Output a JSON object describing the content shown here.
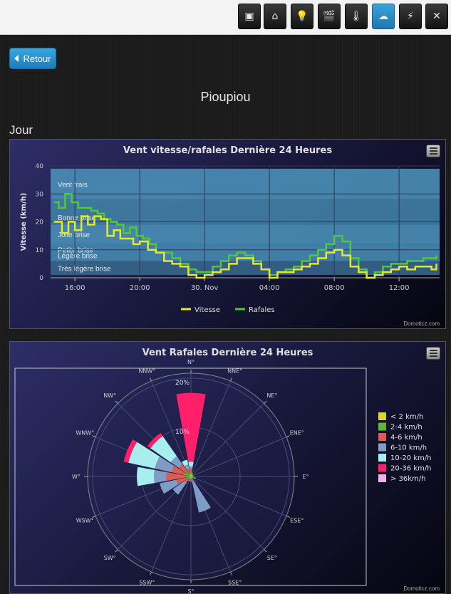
{
  "toolbar": {
    "buttons": [
      {
        "name": "dashboard-icon",
        "glyph": "▣",
        "active": false
      },
      {
        "name": "switches-icon",
        "glyph": "⌂",
        "active": false
      },
      {
        "name": "lightbulb-icon",
        "glyph": "💡",
        "active": false
      },
      {
        "name": "scenes-icon",
        "glyph": "🎬",
        "active": false
      },
      {
        "name": "temperature-icon",
        "glyph": "🌡",
        "active": false
      },
      {
        "name": "weather-icon",
        "glyph": "☁",
        "active": true
      },
      {
        "name": "utility-icon",
        "glyph": "⚡",
        "active": false
      },
      {
        "name": "setup-icon",
        "glyph": "✕",
        "active": false
      }
    ]
  },
  "back_label": "Retour",
  "page_title": "Pioupiou",
  "section_title": "Jour",
  "credit": "Domoticz.com",
  "chart_data": [
    {
      "type": "line",
      "title": "Vent vitesse/rafales Dernière 24 Heures",
      "ylabel": "Vitesse (km/h)",
      "ylim": [
        0,
        40
      ],
      "yticks": [
        0,
        10,
        20,
        30,
        40
      ],
      "xticks": [
        "16:00",
        "20:00",
        "30. Nov",
        "04:00",
        "08:00",
        "12:00"
      ],
      "x_hours": [
        14.5,
        38.5
      ],
      "xtick_hours": [
        16,
        20,
        24,
        28,
        32,
        36
      ],
      "bands": [
        {
          "label": "Vent frais",
          "from": 28,
          "to": 39
        },
        {
          "label": "Bonne brise",
          "from": 19,
          "to": 28
        },
        {
          "label": "Jolie brise",
          "from": 12,
          "to": 19
        },
        {
          "label": "Petite brise",
          "from": 6,
          "to": 12
        },
        {
          "label": "Légère brise",
          "from": 6,
          "to": 12
        },
        {
          "label": "Très légère brise",
          "from": 1,
          "to": 6
        }
      ],
      "series": [
        {
          "name": "Vitesse",
          "color": "#e8e82a",
          "values": [
            [
              14.7,
              20
            ],
            [
              15.2,
              16
            ],
            [
              15.6,
              20
            ],
            [
              16,
              17
            ],
            [
              16.4,
              22
            ],
            [
              16.8,
              19
            ],
            [
              17.2,
              22
            ],
            [
              17.6,
              21
            ],
            [
              18,
              15
            ],
            [
              18.4,
              17
            ],
            [
              18.8,
              14
            ],
            [
              19.2,
              14
            ],
            [
              19.6,
              12
            ],
            [
              20,
              13
            ],
            [
              20.5,
              10
            ],
            [
              21,
              9
            ],
            [
              21.5,
              6
            ],
            [
              22,
              5
            ],
            [
              22.5,
              4
            ],
            [
              23,
              1
            ],
            [
              23.5,
              0
            ],
            [
              24,
              1
            ],
            [
              24.5,
              2
            ],
            [
              25,
              3
            ],
            [
              25.5,
              5
            ],
            [
              26,
              7
            ],
            [
              26.5,
              7
            ],
            [
              27,
              5
            ],
            [
              27.5,
              3
            ],
            [
              28,
              0
            ],
            [
              28.5,
              2
            ],
            [
              29,
              2
            ],
            [
              29.5,
              3
            ],
            [
              30,
              4
            ],
            [
              30.5,
              5
            ],
            [
              31,
              7
            ],
            [
              31.5,
              9
            ],
            [
              32,
              10
            ],
            [
              32.5,
              8
            ],
            [
              33,
              4
            ],
            [
              33.5,
              2
            ],
            [
              34,
              0
            ],
            [
              34.5,
              1
            ],
            [
              35,
              2
            ],
            [
              35.5,
              3
            ],
            [
              36,
              4
            ],
            [
              36.5,
              3
            ],
            [
              37,
              4
            ],
            [
              37.5,
              4
            ],
            [
              38,
              3
            ],
            [
              38.3,
              5
            ]
          ]
        },
        {
          "name": "Rafales",
          "color": "#4fc83c",
          "values": [
            [
              14.7,
              27
            ],
            [
              15,
              25
            ],
            [
              15.4,
              30
            ],
            [
              15.8,
              27
            ],
            [
              16.2,
              25
            ],
            [
              16.6,
              25
            ],
            [
              17,
              24
            ],
            [
              17.4,
              23
            ],
            [
              17.8,
              21
            ],
            [
              18.2,
              20
            ],
            [
              18.6,
              19
            ],
            [
              19,
              16
            ],
            [
              19.4,
              18
            ],
            [
              19.8,
              15
            ],
            [
              20.2,
              14
            ],
            [
              20.6,
              12
            ],
            [
              21,
              9
            ],
            [
              21.5,
              9
            ],
            [
              22,
              7
            ],
            [
              22.5,
              5
            ],
            [
              23,
              3
            ],
            [
              23.5,
              2
            ],
            [
              24,
              2
            ],
            [
              24.5,
              4
            ],
            [
              25,
              6
            ],
            [
              25.5,
              8
            ],
            [
              26,
              9
            ],
            [
              26.5,
              8
            ],
            [
              27,
              6
            ],
            [
              27.5,
              3
            ],
            [
              28,
              1
            ],
            [
              28.5,
              2
            ],
            [
              29,
              3
            ],
            [
              29.5,
              4
            ],
            [
              30,
              6
            ],
            [
              30.5,
              8
            ],
            [
              31,
              10
            ],
            [
              31.5,
              12
            ],
            [
              32,
              15
            ],
            [
              32.5,
              13
            ],
            [
              33,
              7
            ],
            [
              33.5,
              3
            ],
            [
              34,
              0
            ],
            [
              34.5,
              2
            ],
            [
              35,
              4
            ],
            [
              35.5,
              5
            ],
            [
              36,
              5
            ],
            [
              36.5,
              6
            ],
            [
              37,
              6
            ],
            [
              37.5,
              7
            ],
            [
              38,
              7
            ],
            [
              38.3,
              8
            ]
          ]
        }
      ]
    },
    {
      "type": "polar-bar",
      "title": "Vent Rafales Dernière 24 Heures",
      "directions": [
        "N°",
        "NNE°",
        "NE°",
        "ENE°",
        "E°",
        "ESE°",
        "SE°",
        "SSE°",
        "S°",
        "SSW°",
        "SW°",
        "WSW°",
        "W°",
        "WNW°",
        "NW°",
        "NNW°"
      ],
      "radial_labels": [
        "10%",
        "20%"
      ],
      "rmax_percent": 21,
      "categories": [
        "< 2 km/h",
        "2-4 km/h",
        "4-6 km/h",
        "6-10 km/h",
        "10-20 km/h",
        "20-36 km/h",
        "> 36km/h"
      ],
      "colors": [
        "#d8d81c",
        "#58b83a",
        "#d95d52",
        "#7e9cc4",
        "#a8eeee",
        "#ff1f6b",
        "#f3b0ee"
      ],
      "series_cumulative_percent": [
        [
          0.6,
          1.0,
          1.5,
          2.0,
          3.0,
          17.0,
          17.0
        ],
        [
          0.4,
          0.8,
          0.8,
          0.8,
          0.8,
          0.8,
          0.8
        ],
        [
          0.3,
          0.5,
          0.5,
          0.5,
          0.5,
          0.5,
          0.5
        ],
        [
          0.3,
          0.5,
          0.5,
          0.5,
          0.5,
          0.5,
          0.5
        ],
        [
          0.3,
          0.5,
          0.5,
          0.5,
          0.5,
          0.5,
          0.5
        ],
        [
          0.3,
          1.0,
          1.0,
          1.0,
          1.0,
          1.0,
          1.0
        ],
        [
          0.3,
          0.5,
          0.5,
          0.5,
          0.5,
          0.5,
          0.5
        ],
        [
          0.3,
          0.5,
          1.0,
          7.5,
          7.5,
          7.5,
          7.5
        ],
        [
          0.3,
          0.6,
          0.8,
          1.0,
          1.0,
          1.0,
          1.0
        ],
        [
          0.3,
          0.6,
          0.8,
          1.0,
          1.0,
          1.0,
          1.0
        ],
        [
          0.3,
          0.5,
          1.5,
          4.5,
          4.5,
          4.5,
          4.5
        ],
        [
          0.3,
          1.0,
          3.0,
          6.5,
          6.5,
          6.5,
          6.5
        ],
        [
          0.3,
          1.0,
          5.0,
          7.5,
          11.0,
          11.0,
          11.0
        ],
        [
          0.3,
          1.5,
          4.0,
          7.5,
          13.0,
          14.0,
          14.0
        ],
        [
          0.3,
          1.0,
          3.0,
          5.0,
          10.0,
          10.8,
          10.8
        ],
        [
          0.3,
          0.8,
          1.5,
          2.5,
          3.5,
          3.5,
          3.5
        ]
      ]
    }
  ]
}
